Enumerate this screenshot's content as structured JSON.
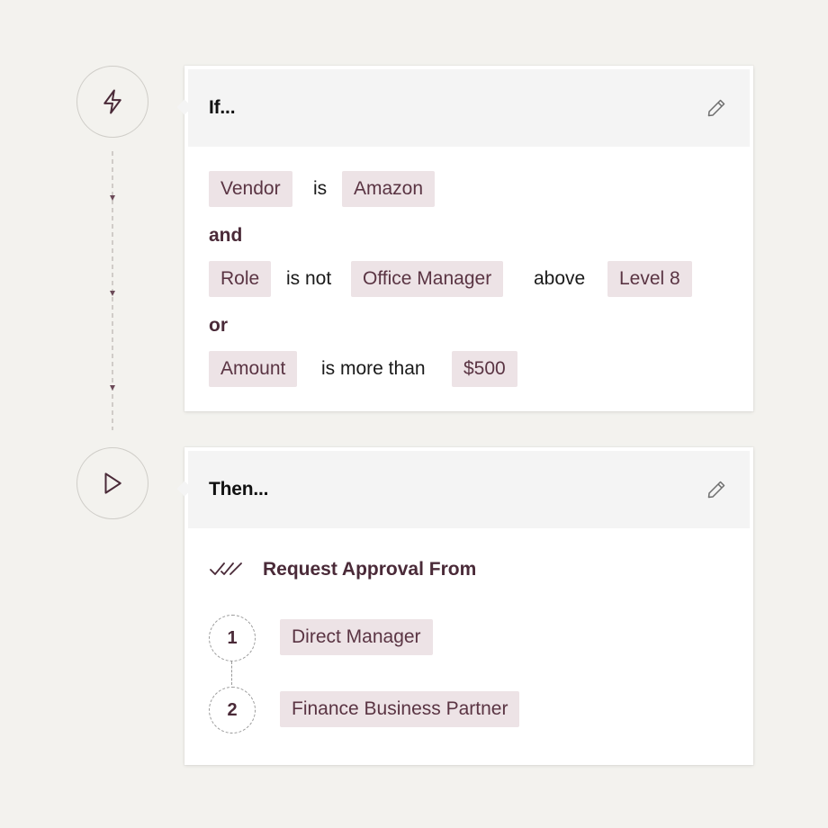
{
  "if_card": {
    "title": "If...",
    "row1": {
      "field": "Vendor",
      "operator": "is",
      "value": "Amazon"
    },
    "conj1": "and",
    "row2": {
      "field": "Role",
      "operator": "is not",
      "value": "Office Manager",
      "operator2": "above",
      "value2": "Level 8"
    },
    "conj2": "or",
    "row3": {
      "field": "Amount",
      "operator": "is more than",
      "value": "$500"
    }
  },
  "then_card": {
    "title": "Then...",
    "action": "Request Approval From",
    "steps": [
      {
        "number": "1",
        "approver": "Direct Manager"
      },
      {
        "number": "2",
        "approver": "Finance Business Partner"
      }
    ]
  },
  "icons": {
    "if_node": "lightning-icon",
    "then_node": "play-icon",
    "edit": "pencil-icon",
    "approval": "double-check-icon"
  },
  "colors": {
    "background": "#f3f2ee",
    "tag_bg": "#ede3e6",
    "tag_text": "#5a3443",
    "accent": "#4a2a38"
  }
}
